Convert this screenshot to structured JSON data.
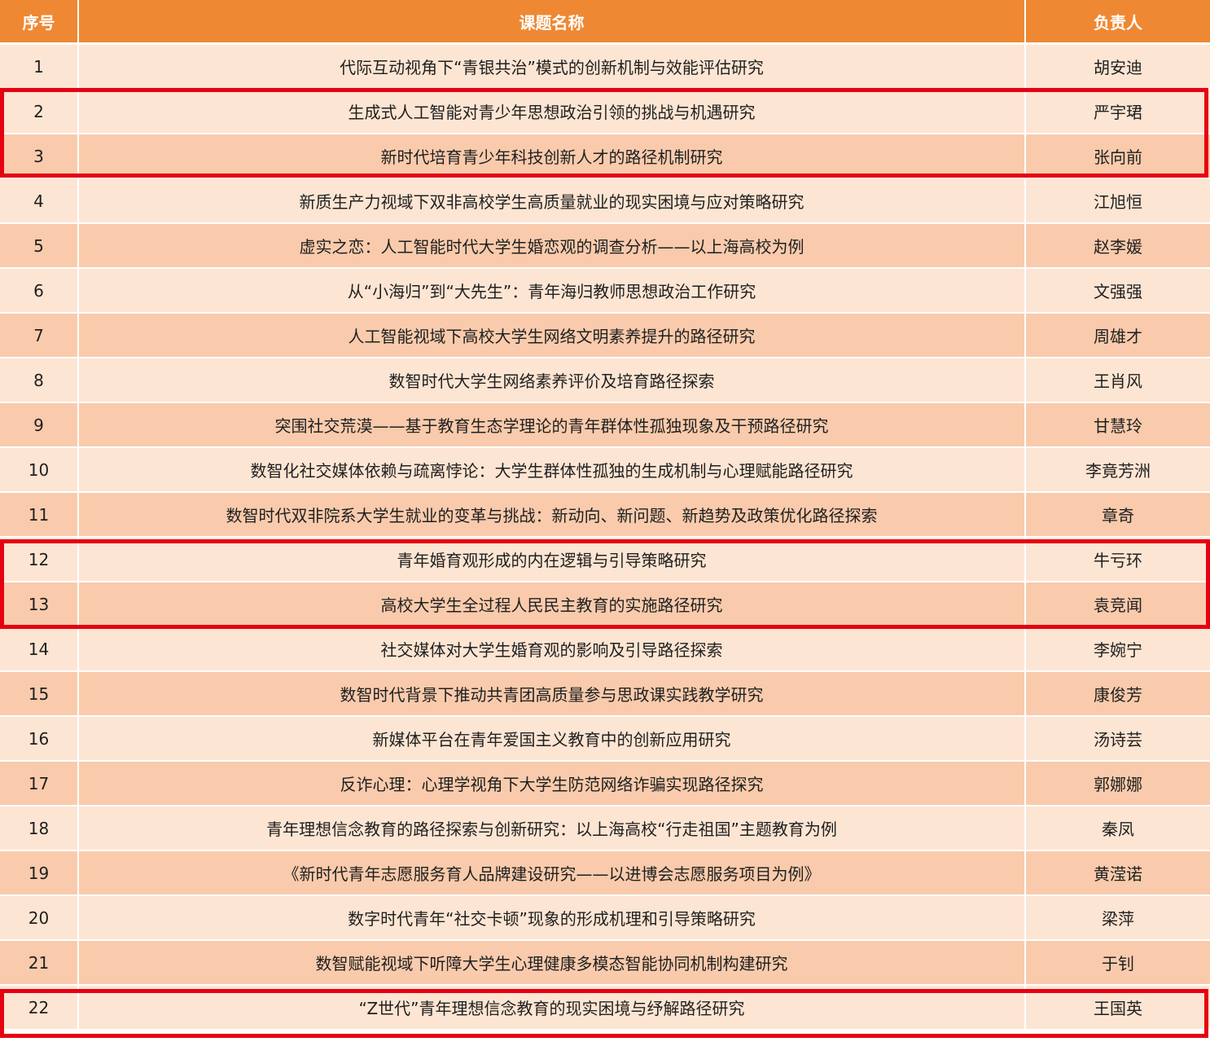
{
  "table": {
    "headers": {
      "index": "序号",
      "title": "课题名称",
      "owner": "负责人"
    },
    "rows": [
      {
        "index": "1",
        "title": "代际互动视角下“青银共治”模式的创新机制与效能评估研究",
        "owner": "胡安迪"
      },
      {
        "index": "2",
        "title": "生成式人工智能对青少年思想政治引领的挑战与机遇研究",
        "owner": "严宇珺"
      },
      {
        "index": "3",
        "title": "新时代培育青少年科技创新人才的路径机制研究",
        "owner": "张向前"
      },
      {
        "index": "4",
        "title": "新质生产力视域下双非高校学生高质量就业的现实困境与应对策略研究",
        "owner": "江旭恒"
      },
      {
        "index": "5",
        "title": "虚实之恋：人工智能时代大学生婚恋观的调查分析——以上海高校为例",
        "owner": "赵李媛"
      },
      {
        "index": "6",
        "title": "从“小海归”到“大先生”：青年海归教师思想政治工作研究",
        "owner": "文强强"
      },
      {
        "index": "7",
        "title": "人工智能视域下高校大学生网络文明素养提升的路径研究",
        "owner": "周雄才"
      },
      {
        "index": "8",
        "title": "数智时代大学生网络素养评价及培育路径探索",
        "owner": "王肖风"
      },
      {
        "index": "9",
        "title": "突围社交荒漠——基于教育生态学理论的青年群体性孤独现象及干预路径研究",
        "owner": "甘慧玲"
      },
      {
        "index": "10",
        "title": "数智化社交媒体依赖与疏离悖论：大学生群体性孤独的生成机制与心理赋能路径研究",
        "owner": "李竟芳洲"
      },
      {
        "index": "11",
        "title": "数智时代双非院系大学生就业的变革与挑战：新动向、新问题、新趋势及政策优化路径探索",
        "owner": "章奇"
      },
      {
        "index": "12",
        "title": "青年婚育观形成的内在逻辑与引导策略研究",
        "owner": "牛亏环"
      },
      {
        "index": "13",
        "title": "高校大学生全过程人民民主教育的实施路径研究",
        "owner": "袁竞闻"
      },
      {
        "index": "14",
        "title": "社交媒体对大学生婚育观的影响及引导路径探索",
        "owner": "李婉宁"
      },
      {
        "index": "15",
        "title": "数智时代背景下推动共青团高质量参与思政课实践教学研究",
        "owner": "康俊芳"
      },
      {
        "index": "16",
        "title": "新媒体平台在青年爱国主义教育中的创新应用研究",
        "owner": "汤诗芸"
      },
      {
        "index": "17",
        "title": "反诈心理：心理学视角下大学生防范网络诈骗实现路径探究",
        "owner": "郭娜娜"
      },
      {
        "index": "18",
        "title": "青年理想信念教育的路径探索与创新研究：以上海高校“行走祖国”主题教育为例",
        "owner": "秦凤"
      },
      {
        "index": "19",
        "title": "《新时代青年志愿服务育人品牌建设研究——以进博会志愿服务项目为例》",
        "owner": "黄滢诺"
      },
      {
        "index": "20",
        "title": "数字时代青年“社交卡顿”现象的形成机理和引导策略研究",
        "owner": "梁萍"
      },
      {
        "index": "21",
        "title": "数智赋能视域下听障大学生心理健康多模态智能协同机制构建研究",
        "owner": "于钊"
      },
      {
        "index": "22",
        "title": "“Z世代”青年理想信念教育的现实困境与纾解路径研究",
        "owner": "王国英"
      }
    ]
  },
  "colors": {
    "header_bg": "#ef8833",
    "row_light": "#fde5d3",
    "row_dark": "#f9cbac",
    "highlight_border": "#e60012"
  }
}
